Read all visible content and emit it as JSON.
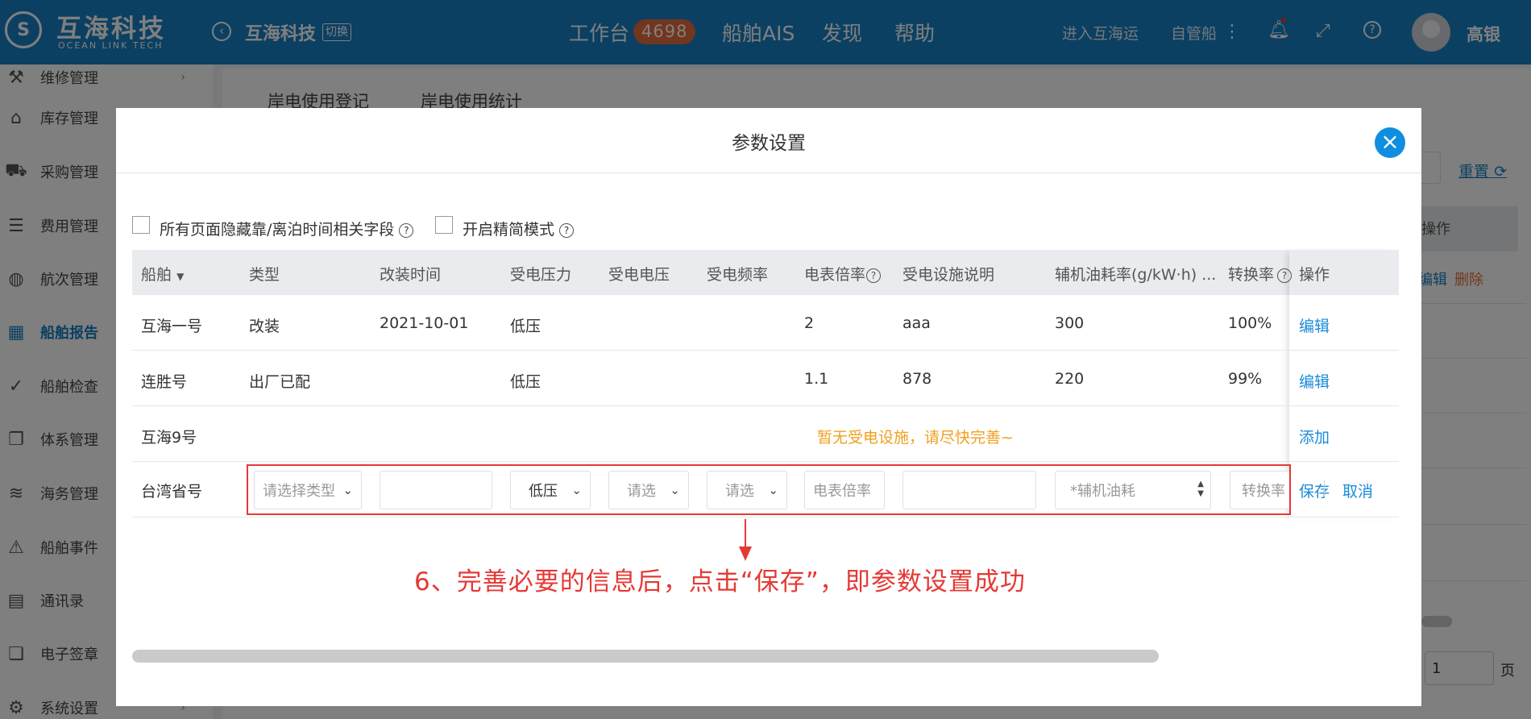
{
  "header": {
    "logo_mark": "S",
    "logo_name": "互海科技",
    "logo_sub": "OCEAN LINK TECH",
    "back_icon": "back-circle-icon",
    "company": "互海科技",
    "switch_label": "切换",
    "nav": {
      "workbench": "工作台",
      "workbench_count": "4698",
      "ais": "船舶AIS",
      "discover": "发现",
      "help": "帮助"
    },
    "enter_label": "进入互海运",
    "own_ship_label": "自管船",
    "user_name": "高银",
    "colors": {
      "bar": "#1680c4",
      "badge": "#e36c3a"
    }
  },
  "sidebar": {
    "items": [
      {
        "label": "维修管理",
        "icon": "wrench-icon"
      },
      {
        "label": "库存管理",
        "icon": "warehouse-icon"
      },
      {
        "label": "采购管理",
        "icon": "cart-icon"
      },
      {
        "label": "费用管理",
        "icon": "coins-icon"
      },
      {
        "label": "航次管理",
        "icon": "globe-icon"
      },
      {
        "label": "船舶报告",
        "icon": "calendar-icon",
        "active": true
      },
      {
        "label": "船舶检查",
        "icon": "check-circle-icon"
      },
      {
        "label": "体系管理",
        "icon": "documents-icon"
      },
      {
        "label": "海务管理",
        "icon": "sea-icon"
      },
      {
        "label": "船舶事件",
        "icon": "warning-icon"
      },
      {
        "label": "通讯录",
        "icon": "contacts-icon"
      },
      {
        "label": "电子签章",
        "icon": "stamp-icon"
      },
      {
        "label": "系统设置",
        "icon": "gear-icon"
      }
    ]
  },
  "background": {
    "tabs": [
      "岸电使用登记",
      "岸电使用统计"
    ],
    "reset_label": "重置",
    "op_header": "操作",
    "edit_label": "编辑",
    "delete_label": "删除",
    "page_value": "1",
    "page_unit": "页"
  },
  "modal": {
    "title": "参数设置",
    "close_icon": "close-icon",
    "options": [
      {
        "label": "所有页面隐藏靠/离泊时间相关字段",
        "checked": false
      },
      {
        "label": "开启精简模式",
        "checked": false
      }
    ],
    "columns": [
      "船舶",
      "类型",
      "改装时间",
      "受电压力",
      "受电电压",
      "受电频率",
      "电表倍率",
      "受电设施说明",
      "辅机油耗率(g/kW·h) ...",
      "转换率",
      "操作"
    ],
    "rows": [
      {
        "ship": "互海一号",
        "type": "改装",
        "date": "2021-10-01",
        "pressure": "低压",
        "voltage": "",
        "frequency": "",
        "ratio": "2",
        "desc": "aaa",
        "fuel": "300",
        "conv": "100%",
        "action": "编辑"
      },
      {
        "ship": "连胜号",
        "type": "出厂已配",
        "date": "",
        "pressure": "低压",
        "voltage": "",
        "frequency": "",
        "ratio": "1.1",
        "desc": "878",
        "fuel": "220",
        "conv": "99%",
        "action": "编辑"
      },
      {
        "ship": "互海9号",
        "notice": "暂无受电设施，请尽快完善~",
        "action": "添加"
      }
    ],
    "edit_row": {
      "ship": "台湾省号",
      "type_placeholder": "请选择类型",
      "date_value": "",
      "pressure_value": "低压",
      "voltage_placeholder": "请选",
      "frequency_placeholder": "请选",
      "ratio_placeholder": "电表倍率",
      "desc_value": "",
      "fuel_placeholder": "*辅机油耗",
      "conv_placeholder": "转换率",
      "save_label": "保存",
      "cancel_label": "取消"
    },
    "annotation": "6、完善必要的信息后，点击“保存”，即参数设置成功",
    "colors": {
      "link": "#1a8bd8",
      "notice": "#f0a020",
      "highlight": "#e53935",
      "close": "#0f8ee0"
    }
  }
}
